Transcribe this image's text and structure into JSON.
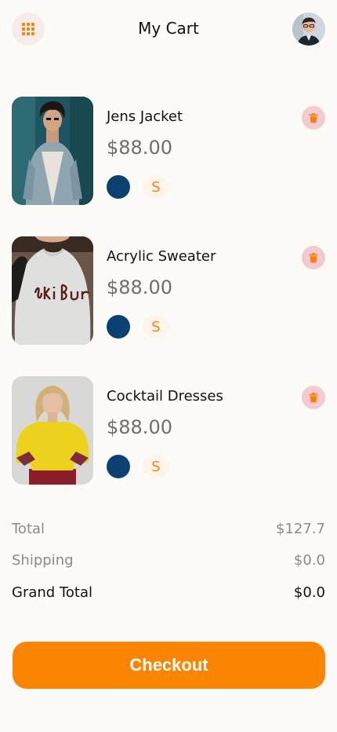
{
  "header": {
    "title": "My Cart",
    "menu_icon": "grid-icon",
    "avatar_icon": "user-avatar"
  },
  "cart": {
    "items": [
      {
        "name": "Jens Jacket",
        "price": "$88.00",
        "color": "#0b4170",
        "size": "S",
        "image": "denim-jacket-photo"
      },
      {
        "name": "Acrylic Sweater",
        "price": "$88.00",
        "color": "#0b4170",
        "size": "S",
        "image": "ski-sweater-photo"
      },
      {
        "name": "Cocktail Dresses",
        "price": "$88.00",
        "color": "#0b4170",
        "size": "S",
        "image": "yellow-sweater-photo"
      }
    ]
  },
  "summary": {
    "total_label": "Total",
    "total_value": "$127.7",
    "shipping_label": "Shipping",
    "shipping_value": "$0.0",
    "grand_label": "Grand Total",
    "grand_value": "$0.0"
  },
  "checkout_label": "Checkout",
  "colors": {
    "accent": "#fb8500",
    "delete_bg": "#f3c9d2",
    "swatch": "#0b4170",
    "background": "#fdfbf8"
  }
}
